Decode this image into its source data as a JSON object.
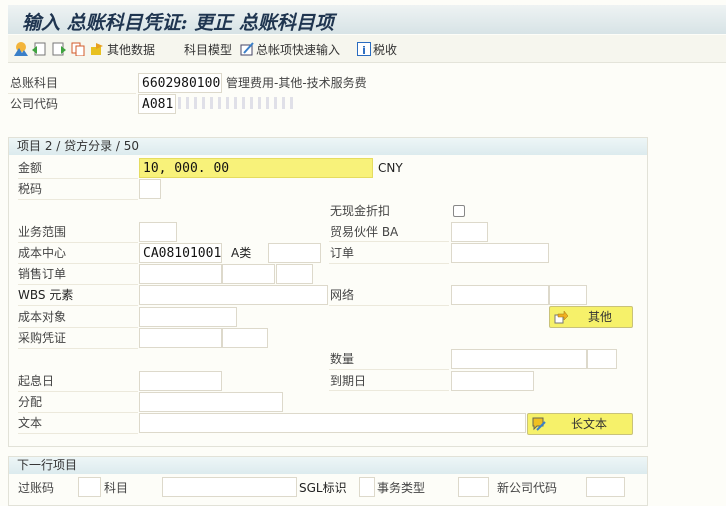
{
  "title": "输入 总账科目凭证: 更正 总账科目项",
  "toolbar": {
    "other_data": "其他数据",
    "account_model": "科目模型",
    "gl_fast_entry": "总帐项快速输入",
    "tax": "税收"
  },
  "header": {
    "gl_account_label": "总账科目",
    "gl_account_value": "6602980100",
    "gl_account_desc": "管理费用-其他-技术服务费",
    "company_code_label": "公司代码",
    "company_code_value": "A081"
  },
  "item": {
    "group_title": "项目 2 / 贷方分录 / 50",
    "amount_label": "金额",
    "amount_value": "10, 000. 00",
    "currency": "CNY",
    "tax_code_label": "税码",
    "no_cash_discount_label": "无现金折扣",
    "no_cash_discount_checked": false,
    "business_area_label": "业务范围",
    "trading_partner_label": "贸易伙伴 BA",
    "cost_center_label": "成本中心",
    "cost_center_value": "CA08101001",
    "cost_center_extra": "A类",
    "order_label": "订单",
    "sales_order_label": "销售订单",
    "wbs_label": "WBS 元素",
    "network_label": "网络",
    "cost_object_label": "成本对象",
    "more_button": "其他",
    "purchasing_doc_label": "采购凭证",
    "quantity_label": "数量",
    "value_date_label": "起息日",
    "due_date_label": "到期日",
    "assignment_label": "分配",
    "text_label": "文本",
    "long_text_button": "长文本"
  },
  "next_item": {
    "group_title": "下一行项目",
    "posting_key_label": "过账码",
    "account_label": "科目",
    "sgl_label": "SGL标识",
    "transaction_type_label": "事务类型",
    "new_company_code_label": "新公司代码"
  }
}
